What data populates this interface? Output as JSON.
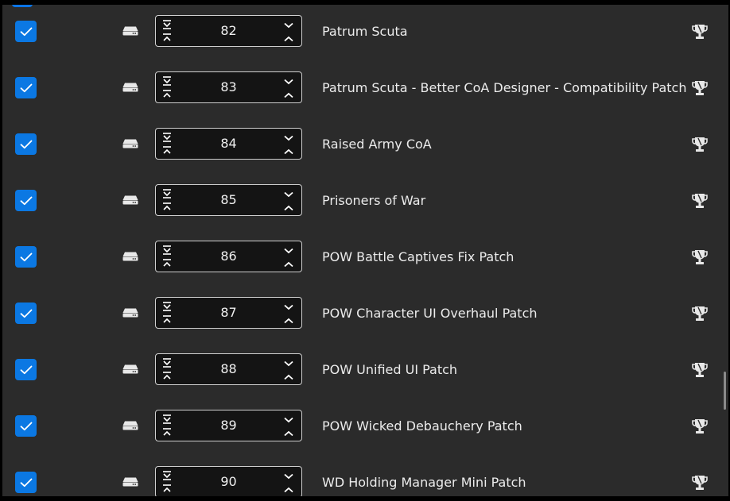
{
  "mods": [
    {
      "order": "82",
      "name": "Patrum Scuta",
      "enabled": true
    },
    {
      "order": "83",
      "name": "Patrum Scuta - Better CoA Designer - Compatibility Patch",
      "enabled": true
    },
    {
      "order": "84",
      "name": "Raised Army CoA",
      "enabled": true
    },
    {
      "order": "85",
      "name": "Prisoners of War",
      "enabled": true
    },
    {
      "order": "86",
      "name": "POW Battle Captives Fix Patch",
      "enabled": true
    },
    {
      "order": "87",
      "name": "POW Character UI Overhaul Patch",
      "enabled": true
    },
    {
      "order": "88",
      "name": "POW Unified UI Patch",
      "enabled": true
    },
    {
      "order": "89",
      "name": "POW Wicked Debauchery Patch",
      "enabled": true
    },
    {
      "order": "90",
      "name": "WD Holding Manager Mini Patch",
      "enabled": true
    }
  ],
  "icons": {
    "checkbox": "checkmark-icon",
    "source": "hard-drive-icon",
    "move_bottom": "move-to-bottom-icon",
    "move_top": "move-to-top-icon",
    "decrement": "chevron-down-icon",
    "increment": "chevron-up-icon",
    "achievement": "trophy-icon"
  },
  "colors": {
    "background": "#2b2b2b",
    "checkbox": "#0b78e3",
    "stepper_bg": "#141414",
    "stepper_border": "#cfcfcf",
    "text": "#ececec"
  }
}
